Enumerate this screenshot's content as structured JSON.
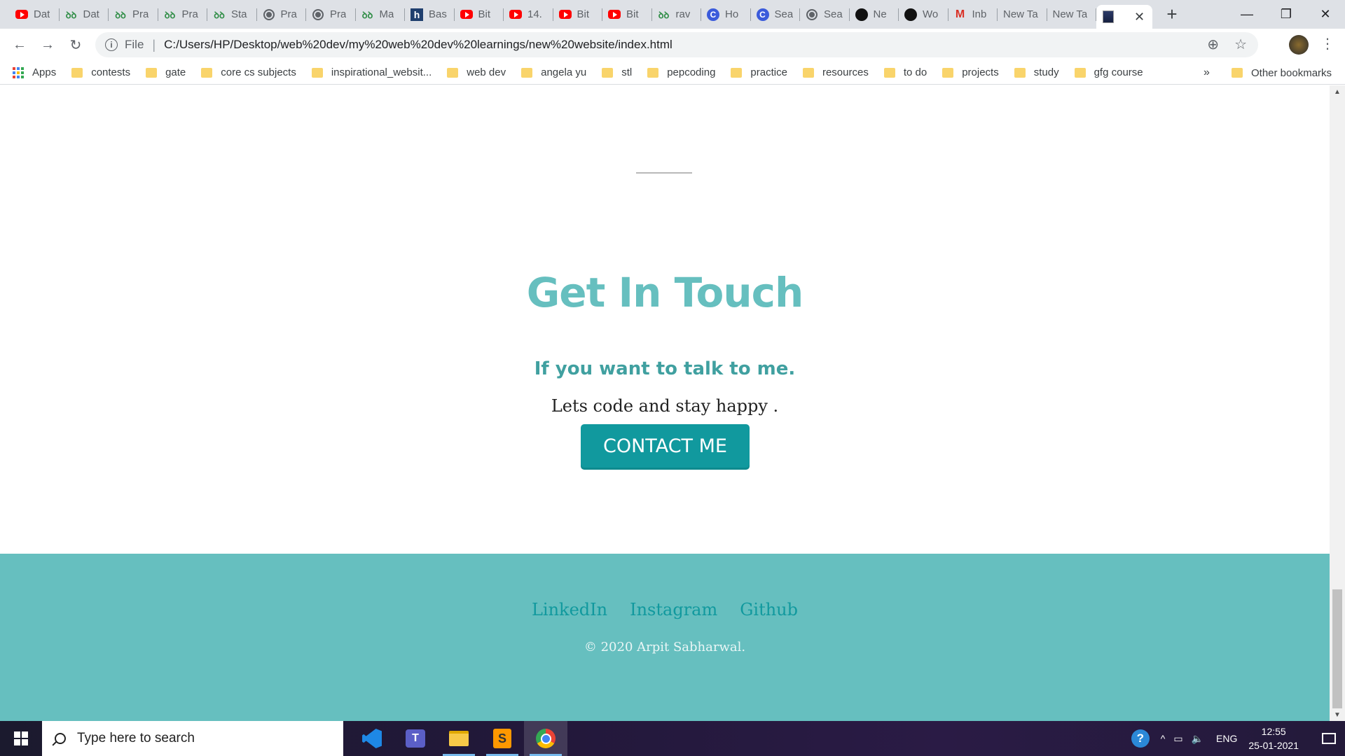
{
  "browser": {
    "tabs": [
      {
        "favicon": "youtube-icon",
        "title": "Dat"
      },
      {
        "favicon": "gfg-icon",
        "title": "Dat"
      },
      {
        "favicon": "gfg-icon",
        "title": "Pra"
      },
      {
        "favicon": "gfg-icon",
        "title": "Pra"
      },
      {
        "favicon": "gfg-icon",
        "title": "Sta"
      },
      {
        "favicon": "globe-icon",
        "title": "Pra"
      },
      {
        "favicon": "globe-icon",
        "title": "Pra"
      },
      {
        "favicon": "gfg-icon",
        "title": "Ma"
      },
      {
        "favicon": "hashnode-icon",
        "title": "Bas"
      },
      {
        "favicon": "youtube-icon",
        "title": "Bit"
      },
      {
        "favicon": "youtube-icon",
        "title": "14."
      },
      {
        "favicon": "youtube-icon",
        "title": "Bit"
      },
      {
        "favicon": "youtube-icon",
        "title": "Bit"
      },
      {
        "favicon": "gfg-icon",
        "title": "rav"
      },
      {
        "favicon": "codechef-icon",
        "title": "Ho"
      },
      {
        "favicon": "codechef-icon",
        "title": "Sea"
      },
      {
        "favicon": "globe-icon",
        "title": "Sea"
      },
      {
        "favicon": "github-icon",
        "title": "Ne"
      },
      {
        "favicon": "github-icon",
        "title": "Wo"
      },
      {
        "favicon": "gmail-icon",
        "title": "Inb"
      },
      {
        "favicon": "",
        "title": "New Ta"
      },
      {
        "favicon": "",
        "title": "New Ta"
      }
    ],
    "new_tab_symbol": "+",
    "close_symbol": "✕",
    "window_controls": {
      "minimize": "—",
      "restore": "❐",
      "close": "✕"
    },
    "nav": {
      "back": "←",
      "forward": "→",
      "reload": "↻"
    },
    "address": {
      "info_symbol": "i",
      "scheme_label": "File",
      "separator": "|",
      "url": "C:/Users/HP/Desktop/web%20dev/my%20web%20dev%20learnings/new%20website/index.html",
      "zoom_symbol": "⊕",
      "star_symbol": "☆"
    },
    "menu_symbol": "⋮",
    "bookmarks": {
      "apps_label": "Apps",
      "folders": [
        "contests",
        "gate",
        "core cs subjects",
        "inspirational_websit...",
        "web dev",
        "angela yu",
        "stl",
        "pepcoding",
        "practice",
        "resources",
        "to do",
        "projects",
        "study",
        "gfg course"
      ],
      "more_symbol": "»",
      "other_label": "Other bookmarks"
    }
  },
  "page": {
    "heading": "Get In Touch",
    "subheading": "If you want to talk to me.",
    "tagline": "Lets code and stay happy .",
    "contact_button": "CONTACT ME",
    "footer": {
      "links": [
        "LinkedIn",
        "Instagram",
        "Github"
      ],
      "copyright": "© 2020 Arpit Sabharwal."
    }
  },
  "scrollbar": {
    "up_symbol": "▲",
    "down_symbol": "▼"
  },
  "taskbar": {
    "search_placeholder": "Type here to search",
    "apps": [
      {
        "name": "vscode-icon",
        "running": false,
        "active": false
      },
      {
        "name": "teams-icon",
        "running": false,
        "active": false
      },
      {
        "name": "file-explorer-icon",
        "running": true,
        "active": false
      },
      {
        "name": "sublime-text-icon",
        "running": true,
        "active": false
      },
      {
        "name": "chrome-icon",
        "running": true,
        "active": true
      }
    ],
    "tray": {
      "help_symbol": "?",
      "chevron_symbol": "^",
      "battery_symbol": "▭",
      "volume_symbol": "🔈",
      "language": "ENG",
      "time": "12:55",
      "date": "25-01-2021"
    }
  },
  "colors": {
    "accent": "#66bfbf",
    "button": "#11999e",
    "footer_link": "#11999e",
    "heading": "#66bfbf"
  }
}
